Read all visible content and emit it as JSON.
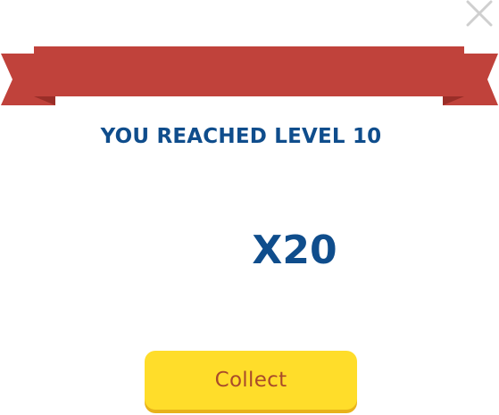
{
  "dialog": {
    "title": "YOU REACHED LEVEL 10",
    "reward": "X20",
    "collect_label": "Collect",
    "close_icon": "close-icon"
  },
  "colors": {
    "banner": "#c0423b",
    "banner_dark": "#9a2e28",
    "text_blue": "#0f4d8c",
    "button_yellow": "#ffdd2a",
    "button_shadow": "#e8b21a",
    "button_text": "#a94b2a",
    "close_gray": "#cfcfcf"
  }
}
